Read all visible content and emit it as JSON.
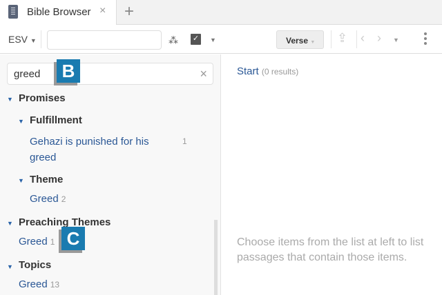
{
  "tab": {
    "title": "Bible Browser",
    "close": "×",
    "new_tab": "+"
  },
  "toolbar": {
    "version": "ESV",
    "reference_value": "",
    "view_mode": "Verse"
  },
  "sidebar": {
    "search_value": "greed",
    "clear": "×",
    "groups": [
      {
        "title": "Promises",
        "subgroups": [
          {
            "title": "Fulfillment",
            "items": [
              {
                "label": "Gehazi is punished for his greed",
                "count": "1"
              }
            ]
          },
          {
            "title": "Theme",
            "items": [
              {
                "label": "Greed",
                "count": "2"
              }
            ]
          }
        ]
      },
      {
        "title": "Preaching Themes",
        "items": [
          {
            "label": "Greed",
            "count": "1"
          }
        ]
      },
      {
        "title": "Topics",
        "items": [
          {
            "label": "Greed",
            "count": "13"
          }
        ]
      }
    ]
  },
  "callouts": {
    "b": "B",
    "c": "C"
  },
  "main": {
    "start": "Start",
    "results": "(0 results)",
    "hint": "Choose items from the list at left to list passages that contain those items."
  }
}
